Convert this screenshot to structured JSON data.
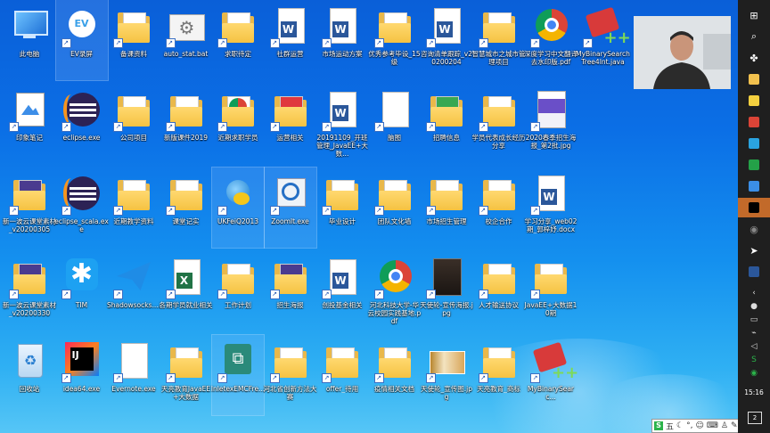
{
  "desktop_icons": [
    {
      "label": "此电脑",
      "type": "pc",
      "col": 0,
      "row": 0
    },
    {
      "label": "EV录屏",
      "type": "ev",
      "col": 1,
      "row": 0,
      "shortcut": true,
      "selected": true
    },
    {
      "label": "备课资料",
      "type": "folder",
      "col": 2,
      "row": 0,
      "shortcut": true
    },
    {
      "label": "auto_stat.bat",
      "type": "bat",
      "col": 3,
      "row": 0,
      "shortcut": true
    },
    {
      "label": "求职待定",
      "type": "folder",
      "col": 4,
      "row": 0,
      "shortcut": true
    },
    {
      "label": "社群运营",
      "type": "word",
      "col": 5,
      "row": 0,
      "shortcut": true
    },
    {
      "label": "市场运动方案",
      "type": "word",
      "col": 6,
      "row": 0,
      "shortcut": true
    },
    {
      "label": "优秀参考毕设_15级",
      "type": "folder",
      "col": 7,
      "row": 0,
      "shortcut": true
    },
    {
      "label": "咨询清单跟踪_v20200204",
      "type": "word",
      "col": 8,
      "row": 0,
      "shortcut": true
    },
    {
      "label": "智慧城市之城市管理项目",
      "type": "folder",
      "col": 9,
      "row": 0,
      "shortcut": true
    },
    {
      "label": "深度学习中文翻译去水印版.pdf",
      "type": "chrome",
      "col": 10,
      "row": 0,
      "shortcut": true
    },
    {
      "label": "MyBinarySearchTree4Int.java",
      "type": "java",
      "col": 11,
      "row": 0,
      "shortcut": true
    },
    {
      "label": "印象笔记",
      "type": "evernote",
      "col": 0,
      "row": 1,
      "shortcut": true
    },
    {
      "label": "eclipse.exe",
      "type": "eclipse",
      "col": 1,
      "row": 1,
      "shortcut": true
    },
    {
      "label": "公司项目",
      "type": "folder",
      "col": 2,
      "row": 1,
      "shortcut": true
    },
    {
      "label": "新版课件2019",
      "type": "folder",
      "col": 3,
      "row": 1,
      "shortcut": true
    },
    {
      "label": "近期求职学员",
      "type": "folder-chrome",
      "col": 4,
      "row": 1,
      "shortcut": true
    },
    {
      "label": "运营相关",
      "type": "folder-red",
      "col": 5,
      "row": 1,
      "shortcut": true
    },
    {
      "label": "20191109_开班管理_JavaEE+大数...",
      "type": "word",
      "col": 6,
      "row": 1,
      "shortcut": true
    },
    {
      "label": "脑图",
      "type": "doc",
      "col": 7,
      "row": 1,
      "shortcut": true
    },
    {
      "label": "招聘信息",
      "type": "folder-green",
      "col": 8,
      "row": 1,
      "shortcut": true
    },
    {
      "label": "学员代表成长经历分享",
      "type": "folder",
      "col": 9,
      "row": 1,
      "shortcut": true
    },
    {
      "label": "2020春季招生海报_第2批.jpg",
      "type": "image",
      "col": 10,
      "row": 1,
      "shortcut": true
    },
    {
      "label": "新一波云课堂素材_v20200305",
      "type": "folder-purple",
      "col": 0,
      "row": 2,
      "shortcut": true
    },
    {
      "label": "eclipse_scala.exe",
      "type": "eclipse",
      "col": 1,
      "row": 2,
      "shortcut": true
    },
    {
      "label": "近期教学资料",
      "type": "folder",
      "col": 2,
      "row": 2,
      "shortcut": true
    },
    {
      "label": "课堂记实",
      "type": "folder",
      "col": 3,
      "row": 2,
      "shortcut": true
    },
    {
      "label": "UKFeiQ2013",
      "type": "feiq",
      "col": 4,
      "row": 2,
      "shortcut": true,
      "selected": true
    },
    {
      "label": "ZoomIt.exe",
      "type": "zoomit",
      "col": 5,
      "row": 2,
      "shortcut": true,
      "selected": true
    },
    {
      "label": "毕业设计",
      "type": "folder",
      "col": 6,
      "row": 2,
      "shortcut": true
    },
    {
      "label": "团队文化墙",
      "type": "folder",
      "col": 7,
      "row": 2,
      "shortcut": true
    },
    {
      "label": "市场招生管理",
      "type": "folder",
      "col": 8,
      "row": 2,
      "shortcut": true
    },
    {
      "label": "校企合作",
      "type": "folder",
      "col": 9,
      "row": 2,
      "shortcut": true
    },
    {
      "label": "学习分享_web02期_郭梓妤.docx",
      "type": "word",
      "col": 10,
      "row": 2,
      "shortcut": true
    },
    {
      "label": "新一波云课堂素材_v20200330",
      "type": "folder-purple",
      "col": 0,
      "row": 3,
      "shortcut": true
    },
    {
      "label": "TIM",
      "type": "tim",
      "col": 1,
      "row": 3,
      "shortcut": true
    },
    {
      "label": "Shadowsocks....",
      "type": "shadowsocks",
      "col": 2,
      "row": 3,
      "shortcut": true
    },
    {
      "label": "各期学员就业相关",
      "type": "excel",
      "col": 3,
      "row": 3,
      "shortcut": true
    },
    {
      "label": "工作计划",
      "type": "folder",
      "col": 4,
      "row": 3,
      "shortcut": true
    },
    {
      "label": "招生海报",
      "type": "folder-purple",
      "col": 5,
      "row": 3,
      "shortcut": true
    },
    {
      "label": "创投基金相关",
      "type": "word",
      "col": 6,
      "row": 3,
      "shortcut": true
    },
    {
      "label": "河北科技大学-华云校园实践基地.pdf",
      "type": "chrome",
      "col": 7,
      "row": 3,
      "shortcut": true
    },
    {
      "label": "天使轮-宣传海报.jpg",
      "type": "dark-image",
      "col": 8,
      "row": 3,
      "shortcut": true
    },
    {
      "label": "人才输送协议",
      "type": "folder",
      "col": 9,
      "row": 3,
      "shortcut": true
    },
    {
      "label": "JavaEE+大数据10期",
      "type": "folder",
      "col": 10,
      "row": 3,
      "shortcut": true
    },
    {
      "label": "回收站",
      "type": "recycle",
      "col": 0,
      "row": 4
    },
    {
      "label": "idea64.exe",
      "type": "idea",
      "col": 1,
      "row": 4,
      "shortcut": true
    },
    {
      "label": "Evernote.exe",
      "type": "blank",
      "col": 2,
      "row": 4,
      "shortcut": true
    },
    {
      "label": "天亮教育JavaEE+大数据",
      "type": "folder",
      "col": 3,
      "row": 4,
      "shortcut": true
    },
    {
      "label": "InletexEMCFre...",
      "type": "inletex",
      "col": 4,
      "row": 4,
      "shortcut": true,
      "selected": true
    },
    {
      "label": "河北省创新方法大赛",
      "type": "folder",
      "col": 5,
      "row": 4,
      "shortcut": true
    },
    {
      "label": "offer_待用",
      "type": "folder",
      "col": 6,
      "row": 4,
      "shortcut": true
    },
    {
      "label": "疫情相关文档",
      "type": "folder",
      "col": 7,
      "row": 4,
      "shortcut": true
    },
    {
      "label": "天使轮_宣传图.jpg",
      "type": "photo",
      "col": 8,
      "row": 4,
      "shortcut": true
    },
    {
      "label": "天亮教育_商标",
      "type": "folder",
      "col": 9,
      "row": 4,
      "shortcut": true
    },
    {
      "label": "MyBinarySearc...",
      "type": "java",
      "col": 10,
      "row": 4,
      "shortcut": true
    }
  ],
  "taskbar": {
    "icons": [
      "windows-logo",
      "search-icon",
      "pinwheel-icon",
      "file-explorer-icon",
      "sticky-notes-icon",
      "chrome-icon",
      "telegram-icon",
      "green-app-icon",
      "blue-app-icon",
      "qq-icon",
      "record-icon",
      "cursor-icon",
      "word-icon"
    ],
    "tray": [
      "chevron-up-icon",
      "wechat-icon",
      "battery-icon",
      "network-icon",
      "volume-icon",
      "s-icon",
      "green-circle-icon"
    ],
    "time": "15:16",
    "notification_count": "2"
  },
  "ime_bar": {
    "label": "五"
  }
}
